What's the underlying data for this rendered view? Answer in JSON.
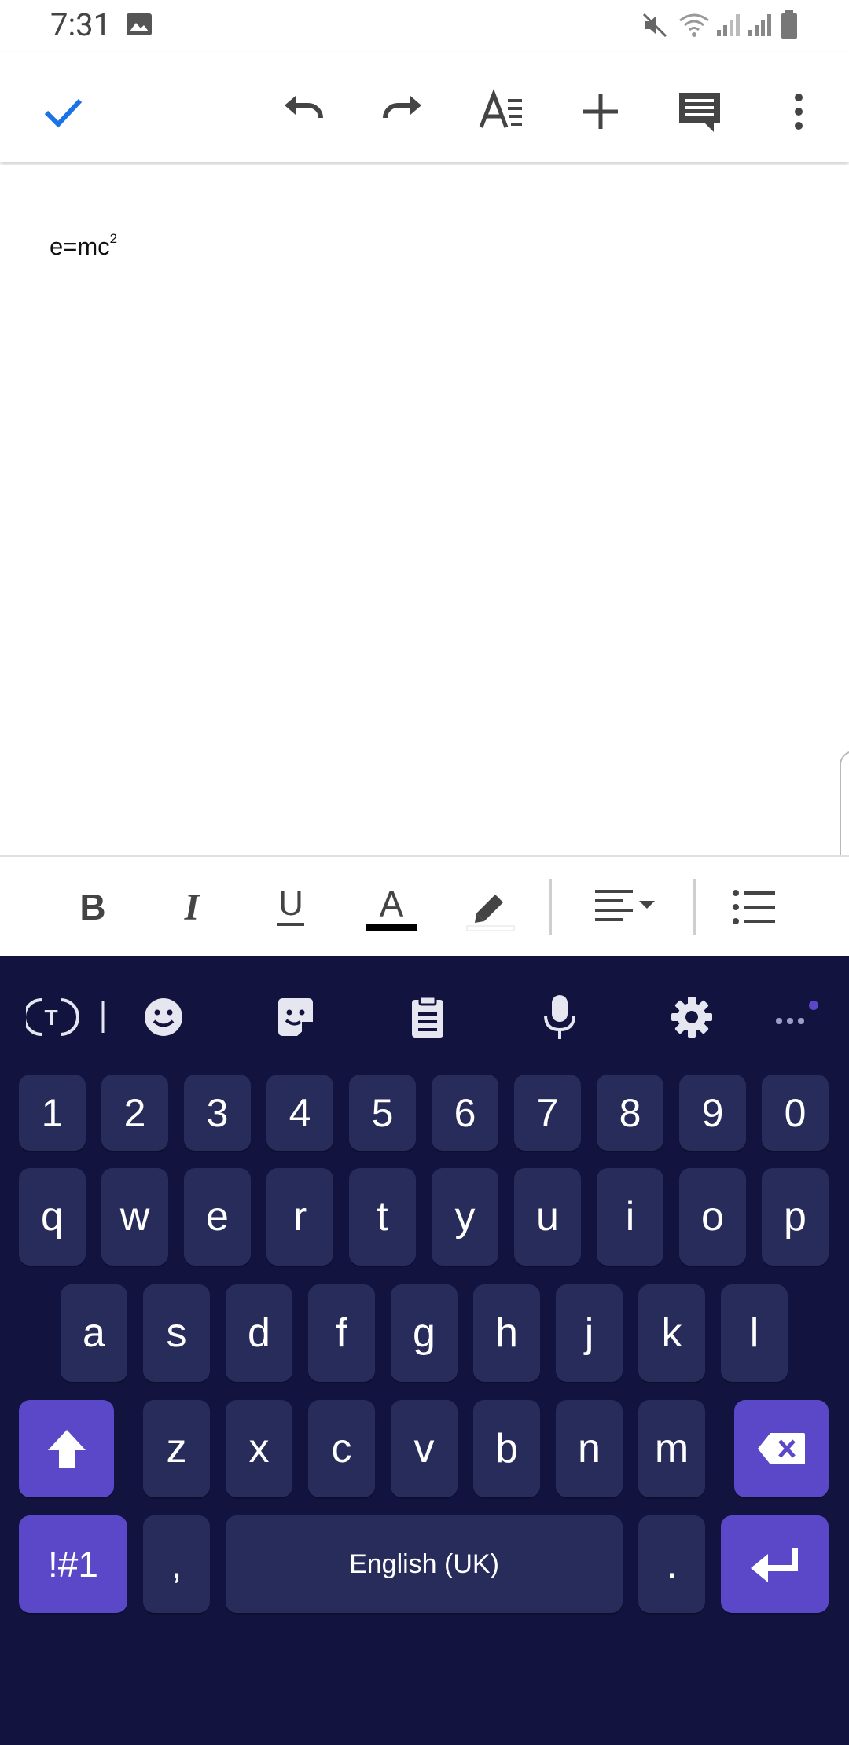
{
  "status_bar": {
    "time": "7:31"
  },
  "document": {
    "text_main": "e=mc",
    "text_sup": "2"
  },
  "keyboard": {
    "number_row": [
      "1",
      "2",
      "3",
      "4",
      "5",
      "6",
      "7",
      "8",
      "9",
      "0"
    ],
    "row1": [
      "q",
      "w",
      "e",
      "r",
      "t",
      "y",
      "u",
      "i",
      "o",
      "p"
    ],
    "row2": [
      "a",
      "s",
      "d",
      "f",
      "g",
      "h",
      "j",
      "k",
      "l"
    ],
    "row3": [
      "z",
      "x",
      "c",
      "v",
      "b",
      "n",
      "m"
    ],
    "symbols_label": "!#1",
    "comma_label": ",",
    "space_label": "English (UK)",
    "period_label": "."
  },
  "colors": {
    "accent": "#1a73e8",
    "keyboard_bg": "#13133f",
    "key_bg": "#282c5a",
    "key_accent": "#5a48c8"
  }
}
